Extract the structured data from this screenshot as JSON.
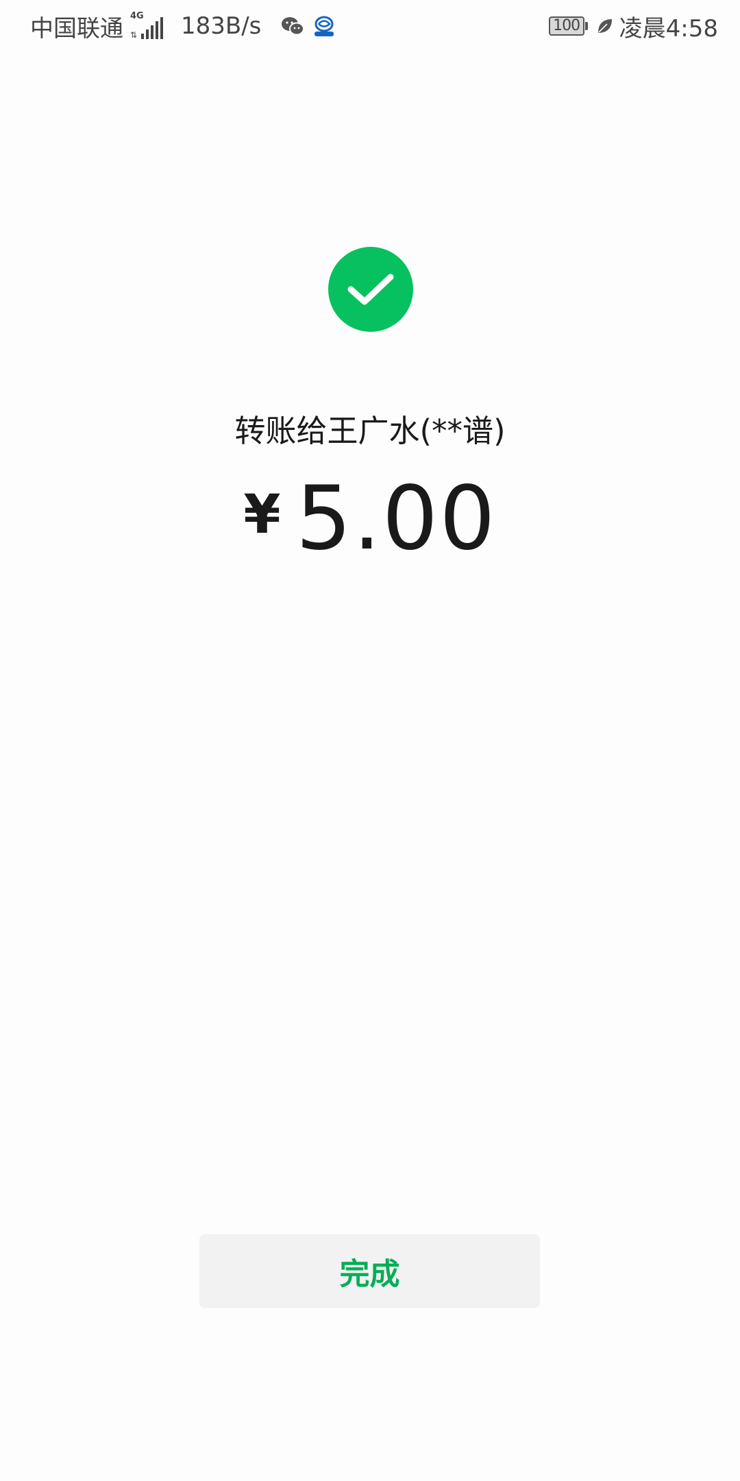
{
  "status_bar": {
    "carrier": "中国联通",
    "network_type": "4G",
    "net_speed": "183B/s",
    "battery_level": "100",
    "time": "凌晨4:58",
    "icons": [
      "signal-icon",
      "wechat-icon",
      "browser-icon",
      "battery-icon",
      "leaf-icon"
    ]
  },
  "result": {
    "recipient_text": "转账给王广水(**谱)",
    "currency_symbol": "¥",
    "amount": "5.00",
    "icon": "check-icon"
  },
  "actions": {
    "done_label": "完成"
  },
  "colors": {
    "success_green": "#07c160",
    "button_text_green": "#06ae56",
    "button_bg": "#f2f2f2",
    "text_primary": "#1a1a1a"
  }
}
